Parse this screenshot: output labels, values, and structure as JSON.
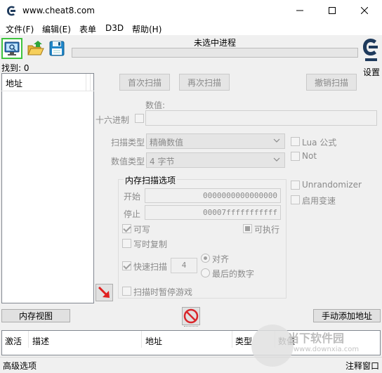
{
  "window": {
    "title": "www.cheat8.com"
  },
  "menu": {
    "items": [
      "文件(F)",
      "编辑(E)",
      "表单",
      "D3D",
      "帮助(H)"
    ]
  },
  "toolbar": {
    "process_label": "未选中进程",
    "found_label": "找到: 0",
    "settings_label": "设置",
    "icons": [
      "open-process-icon",
      "open-file-icon",
      "save-icon"
    ]
  },
  "address_list": {
    "header": "地址"
  },
  "scan": {
    "first_scan": "首次扫描",
    "next_scan": "再次扫描",
    "undo_scan": "撤销扫描",
    "value_label": "数值:",
    "hex_label": "十六进制",
    "scan_type_label": "扫描类型",
    "scan_type_value": "精确数值",
    "value_type_label": "数值类型",
    "value_type_value": "4 字节",
    "lua_formula": "Lua 公式",
    "not_label": "Not",
    "unrandomizer": "Unrandomizer",
    "enable_speedhack": "启用变速"
  },
  "memory_options": {
    "title": "内存扫描选项",
    "start_label": "开始",
    "start_value": "0000000000000000",
    "stop_label": "停止",
    "stop_value": "00007fffffffffff",
    "writable": "可写",
    "executable": "可执行",
    "copy_on_write": "写时复制",
    "fast_scan": "快速扫描",
    "fast_scan_value": "4",
    "alignment": "对齐",
    "last_digits": "最后的数字",
    "pause_game": "扫描时暂停游戏"
  },
  "actions": {
    "memory_view": "内存视图",
    "add_address_manually": "手动添加地址"
  },
  "table": {
    "columns": [
      "激活",
      "描述",
      "地址",
      "类型",
      "数值"
    ]
  },
  "status": {
    "advanced_options": "高级选项",
    "comment_window": "注释窗口"
  },
  "watermark": {
    "line1": "当下软件园",
    "line2": "www.downxia.com"
  },
  "colors": {
    "selected_outline": "#3ec33e",
    "stop_red": "#d9262b",
    "arrow_red": "#e02020"
  }
}
